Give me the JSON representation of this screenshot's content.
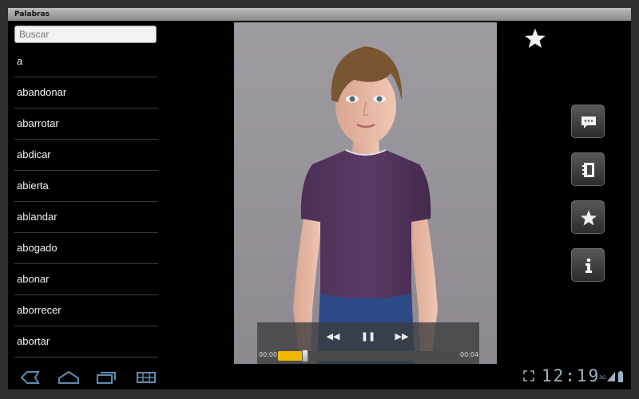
{
  "window": {
    "title": "Palabras"
  },
  "search": {
    "placeholder": "Buscar",
    "value": ""
  },
  "words": [
    "a",
    "abandonar",
    "abarrotar",
    "abdicar",
    "abierta",
    "ablandar",
    "abogado",
    "abonar",
    "aborrecer",
    "abortar"
  ],
  "player": {
    "current_time": "00:00",
    "duration": "00:04",
    "progress": 0.15
  },
  "side_buttons": [
    "chat-icon",
    "notebook-icon",
    "star-icon",
    "info-icon"
  ],
  "status": {
    "clock": "12:19",
    "signal_label": "3G"
  },
  "colors": {
    "progress": "#f1b800",
    "clock": "#9bb4c2"
  }
}
